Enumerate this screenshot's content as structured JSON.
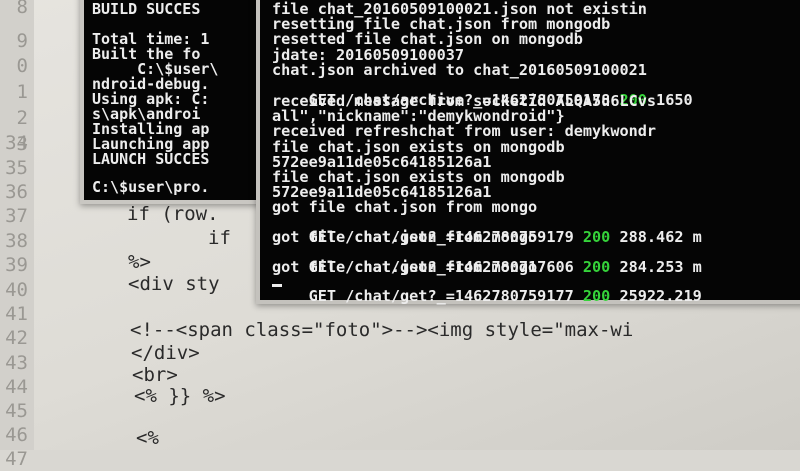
{
  "editor": {
    "gutter": [
      "8",
      "9",
      "0",
      "1",
      "2",
      "3",
      "34",
      "35",
      "36",
      "37",
      "38",
      "39",
      "40",
      "41",
      "42",
      "43",
      "44",
      "45",
      "46",
      "47"
    ],
    "lines": [
      "if (row.",
      "if",
      "%>",
      "<div sty",
      "",
      "<!--<span class=\"foto\">--><img style=\"max-wi",
      "</div>",
      "<br>",
      "<% }} %>",
      "",
      "<%"
    ]
  },
  "console_back": {
    "lines": [
      "BUILD SUCCES",
      "",
      "Total time: 1",
      "Built the fo",
      "     C:\\$user\\",
      "ndroid-debug.",
      "Using apk: C:",
      "s\\apk\\androi",
      "Installing ap",
      "Launching app",
      "LAUNCH SUCCES",
      "",
      "C:\\$user\\pro."
    ]
  },
  "console_front": {
    "lines": [
      {
        "text": "file chat_20160509100021.json not existin"
      },
      {
        "text": "resetting file chat.json from mongodb"
      },
      {
        "text": "resetted file chat.json on mongodb"
      },
      {
        "text": "jdate: 20160509100037"
      },
      {
        "text": "chat.json archived to chat_20160509100021"
      },
      {
        "text": "GET /chat/archive?_=1462780759178 ",
        "status": "200",
        "tail": " 1650"
      },
      {
        "text": "received message from socketid ALQA5u6LCvs"
      },
      {
        "text": "all\",\"nickname\":\"demykwondroid\"}"
      },
      {
        "text": "received refreshchat from user: demykwondr"
      },
      {
        "text": "file chat.json exists on mongodb"
      },
      {
        "text": "572ee9a11de05c64185126a1"
      },
      {
        "text": "file chat.json exists on mongodb"
      },
      {
        "text": "572ee9a11de05c64185126a1"
      },
      {
        "text": "got file chat.json from mongo"
      },
      {
        "text": "GET /chat/get?_=1462780759179 ",
        "status": "200",
        "tail": " 288.462 m"
      },
      {
        "text": "got file chat.json from mongo"
      },
      {
        "text": "GET /chat/get?_=1462780717606 ",
        "status": "200",
        "tail": " 284.253 m"
      },
      {
        "text": "got file chat.json from mongo"
      },
      {
        "text": "GET /chat/get?_=1462780759177 ",
        "status": "200",
        "tail": " 25922.219"
      }
    ]
  }
}
